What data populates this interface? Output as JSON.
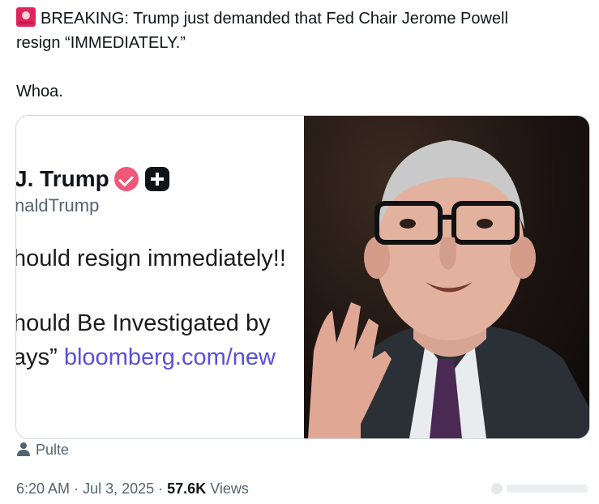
{
  "tweet": {
    "line1": "BREAKING: Trump just demanded that Fed Chair Jerome Powell",
    "line2": "resign “IMMEDIATELY.”",
    "line3": "Whoa."
  },
  "media": {
    "screenshot": {
      "name": "J. Trump",
      "handle": "naldTrump",
      "post_line1": "hould resign immediately!!",
      "post_line2": "hould Be Investigated by",
      "post_line3_text": "ays”",
      "post_line3_link": "bloomberg.com/new"
    },
    "photo": {
      "subject": "photo of Jerome Powell speaking"
    }
  },
  "author_label": "Pulte",
  "meta": {
    "time": "6:20 AM",
    "date": "Jul 3, 2025",
    "views_count": "57.6K",
    "views_label": "Views"
  },
  "icons": {
    "siren": "siren-emoji-icon",
    "verified": "verified-badge-icon",
    "plus": "plus-app-icon",
    "person": "person-icon"
  },
  "colors": {
    "text": "#0f1419",
    "muted": "#536471",
    "link": "#5a4ee0",
    "badge": "#f0587a"
  }
}
